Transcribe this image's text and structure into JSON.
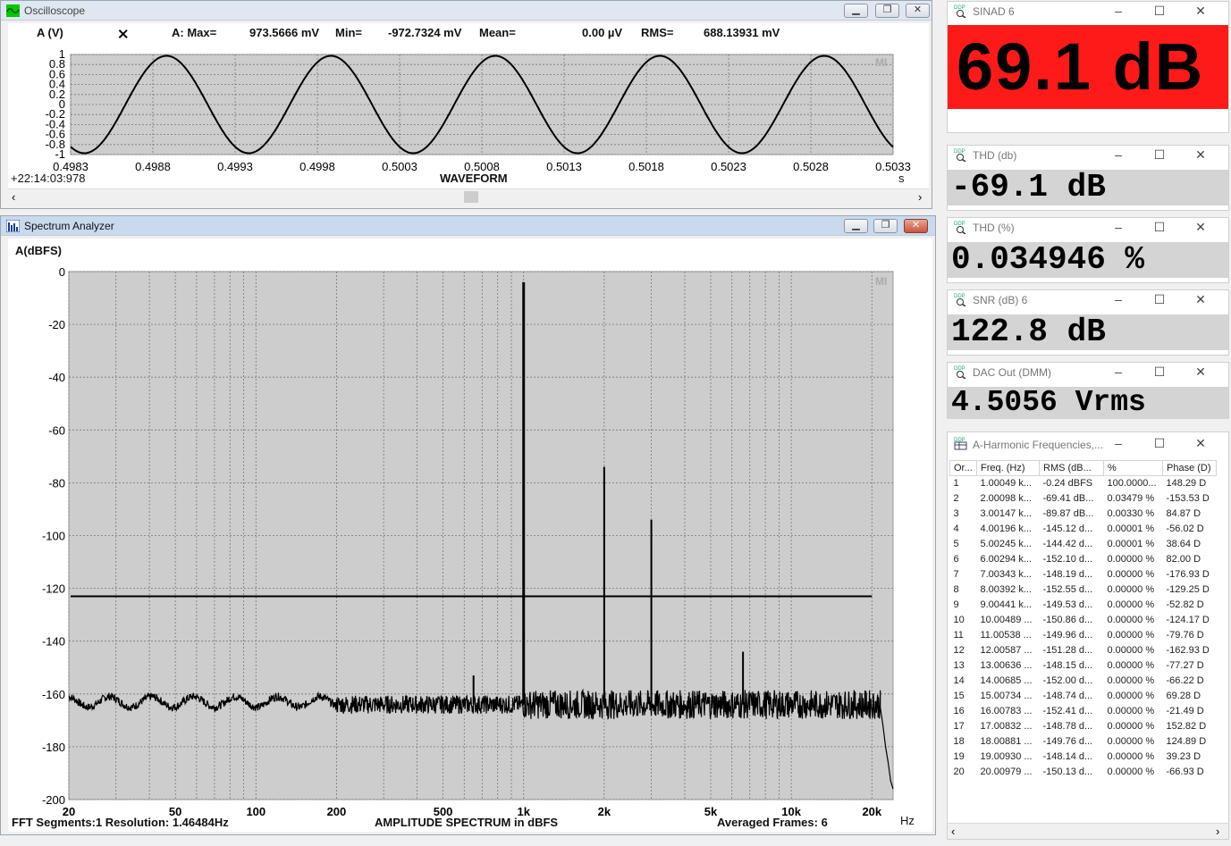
{
  "oscilloscope": {
    "title": "Oscilloscope",
    "channel_label": "A (V)",
    "stats": {
      "max_label": "A: Max=",
      "max_value": "973.5666 mV",
      "min_label": "Min=",
      "min_value": "-972.7324 mV",
      "mean_label": "Mean=",
      "mean_value": "0.00  µV",
      "rms_label": "RMS=",
      "rms_value": "688.13931 mV"
    },
    "y_ticks": [
      "1",
      "0.8",
      "0.6",
      "0.4",
      "0.2",
      "0",
      "-0.2",
      "-0.4",
      "-0.6",
      "-0.8",
      "-1"
    ],
    "x_ticks": [
      "0.4983",
      "0.4988",
      "0.4993",
      "0.4998",
      "0.5003",
      "0.5008",
      "0.5013",
      "0.5018",
      "0.5023",
      "0.5028",
      "0.5033"
    ],
    "timestamp": "+22:14:03:978",
    "x_title": "WAVEFORM",
    "x_unit": "s",
    "watermark": "MI",
    "chart_data": {
      "type": "line",
      "xlabel": "WAVEFORM",
      "ylabel": "A (V)",
      "xlim": [
        0.4983,
        0.5033
      ],
      "ylim": [
        -1,
        1
      ],
      "grid": true,
      "series": [
        {
          "frequency_hz": 1000.49,
          "amplitude_v": 0.973,
          "start_phase_deg": -120
        }
      ]
    }
  },
  "spectrum": {
    "title": "Spectrum Analyzer",
    "channel_label": "A(dBFS)",
    "y_ticks": [
      "0",
      "-20",
      "-40",
      "-60",
      "-80",
      "-100",
      "-120",
      "-140",
      "-160",
      "-180",
      "-200"
    ],
    "x_ticks": [
      "20",
      "50",
      "100",
      "200",
      "500",
      "1k",
      "2k",
      "5k",
      "10k",
      "20k"
    ],
    "x_unit": "Hz",
    "footer_left": "FFT Segments:1   Resolution: 1.46484Hz",
    "footer_center": "AMPLITUDE SPECTRUM in dBFS",
    "footer_right": "Averaged Frames: 6",
    "watermark": "MI",
    "chart_data": {
      "type": "line",
      "ylabel": "A(dBFS)",
      "x_scale": "log",
      "xlim": [
        20,
        24000
      ],
      "ylim": [
        -200,
        0
      ],
      "grid": true,
      "noise_floor_db": -164,
      "reference_line_db": -123,
      "peaks": [
        {
          "freq_hz": 1000,
          "db": -4
        },
        {
          "freq_hz": 2000,
          "db": -74
        },
        {
          "freq_hz": 3000,
          "db": -94
        },
        {
          "freq_hz": 650,
          "db": -153
        },
        {
          "freq_hz": 6600,
          "db": -144
        }
      ]
    }
  },
  "meters": [
    {
      "title": "SINAD  6",
      "value": "69.1 dB",
      "bg": "#ff1a1a"
    },
    {
      "title": "THD (db)",
      "value": "-69.1  dB",
      "bg": "#d4d4d4"
    },
    {
      "title": "THD (%)",
      "value": "0.034946 %",
      "bg": "#d4d4d4"
    },
    {
      "title": "SNR (dB)  6",
      "value": "122.8  dB",
      "bg": "#d4d4d4"
    },
    {
      "title": "DAC Out (DMM)",
      "value": "4.5056 Vrms",
      "bg": "#d4d4d4"
    }
  ],
  "harmonics": {
    "title": "A-Harmonic Frequencies,...",
    "columns": [
      "Or...",
      "Freq. (Hz)",
      "RMS (dB...",
      "%",
      "Phase (D)"
    ],
    "rows": [
      [
        "1",
        "1.00049 k...",
        "-0.24 dBFS",
        "100.0000...",
        "148.29  D"
      ],
      [
        "2",
        "2.00098 k...",
        "-69.41 dB...",
        "0.03479  %",
        "-153.53  D"
      ],
      [
        "3",
        "3.00147 k...",
        "-89.87 dB...",
        "0.00330  %",
        "84.87  D"
      ],
      [
        "4",
        "4.00196 k...",
        "-145.12 d...",
        "0.00001  %",
        "-56.02  D"
      ],
      [
        "5",
        "5.00245 k...",
        "-144.42 d...",
        "0.00001  %",
        "38.64  D"
      ],
      [
        "6",
        "6.00294 k...",
        "-152.10 d...",
        "0.00000  %",
        "82.00  D"
      ],
      [
        "7",
        "7.00343 k...",
        "-148.19 d...",
        "0.00000  %",
        "-176.93  D"
      ],
      [
        "8",
        "8.00392 k...",
        "-152.55 d...",
        "0.00000  %",
        "-129.25  D"
      ],
      [
        "9",
        "9.00441 k...",
        "-149.53 d...",
        "0.00000  %",
        "-52.82  D"
      ],
      [
        "10",
        "10.00489 ...",
        "-150.86 d...",
        "0.00000  %",
        "-124.17  D"
      ],
      [
        "11",
        "11.00538 ...",
        "-149.96 d...",
        "0.00000  %",
        "-79.76  D"
      ],
      [
        "12",
        "12.00587 ...",
        "-151.28 d...",
        "0.00000  %",
        "-162.93  D"
      ],
      [
        "13",
        "13.00636 ...",
        "-148.15 d...",
        "0.00000  %",
        "-77.27  D"
      ],
      [
        "14",
        "14.00685 ...",
        "-152.00 d...",
        "0.00000  %",
        "-66.22  D"
      ],
      [
        "15",
        "15.00734 ...",
        "-148.74 d...",
        "0.00000  %",
        "69.28  D"
      ],
      [
        "16",
        "16.00783 ...",
        "-152.41 d...",
        "0.00000  %",
        "-21.49  D"
      ],
      [
        "17",
        "17.00832 ...",
        "-148.78 d...",
        "0.00000  %",
        "152.82  D"
      ],
      [
        "18",
        "18.00881 ...",
        "-149.76 d...",
        "0.00000  %",
        "124.89  D"
      ],
      [
        "19",
        "19.00930 ...",
        "-148.14 d...",
        "0.00000  %",
        "39.23  D"
      ],
      [
        "20",
        "20.00979 ...",
        "-150.13 d...",
        "0.00000  %",
        "-66.93  D"
      ]
    ]
  }
}
